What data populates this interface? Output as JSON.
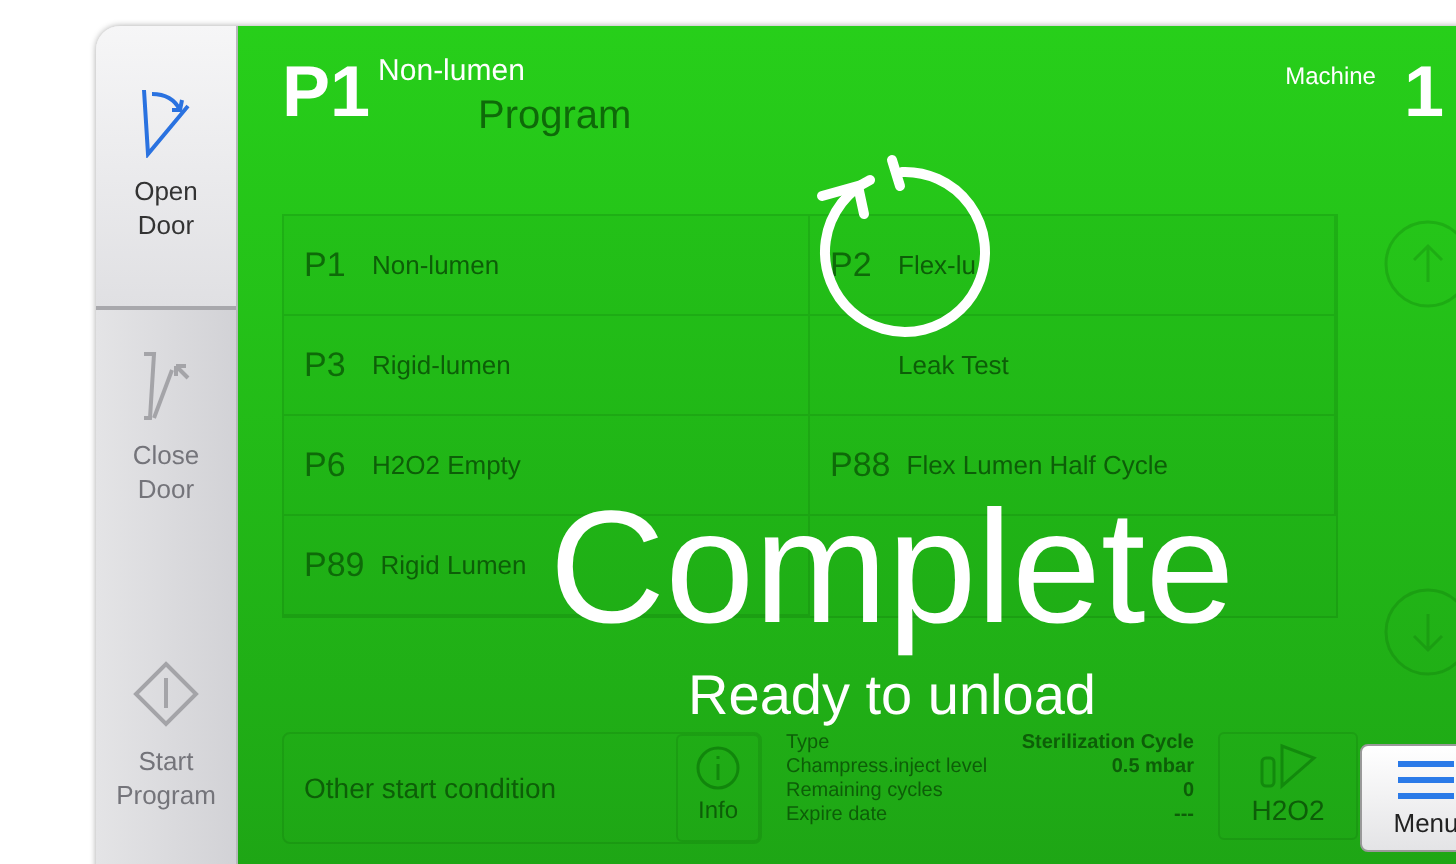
{
  "sidebar": {
    "items": [
      {
        "kind": "open-door",
        "label": "Open Door",
        "disabled": false
      },
      {
        "kind": "close-door",
        "label": "Close Door",
        "disabled": true
      },
      {
        "kind": "start-program",
        "label": "Start Program",
        "disabled": true
      }
    ]
  },
  "program_select": {
    "title": "Program",
    "programs": [
      {
        "code": "P1",
        "name": "Non-lumen"
      },
      {
        "code": "P2",
        "name": "Flex-lu"
      },
      {
        "code": "P3",
        "name": "Rigid-lumen"
      },
      {
        "name": "Leak Test"
      },
      {
        "code": "P6",
        "name": "H2O2 Empty"
      },
      {
        "code": "P88",
        "name": "Flex Lumen Half Cycle"
      },
      {
        "code": "P89",
        "name": "Rigid Lumen"
      }
    ],
    "start_condition": {
      "label": "Other start condition",
      "info_button": "Info"
    },
    "cycle_info": [
      {
        "label": "Type",
        "value": "Sterilization Cycle"
      },
      {
        "label": "Champress.inject level",
        "value": "0.5 mbar"
      },
      {
        "label": "Remaining cycles",
        "value": "0"
      },
      {
        "label": "Expire date",
        "value": "---"
      }
    ],
    "h2o2_button": "H2O2"
  },
  "overlay": {
    "program_code": "P1",
    "program_name": "Non-lumen",
    "machine_label": "Machine",
    "machine_number": "1",
    "status": "Complete",
    "message": "Ready to unload"
  },
  "menu_button": {
    "label": "Menu"
  }
}
